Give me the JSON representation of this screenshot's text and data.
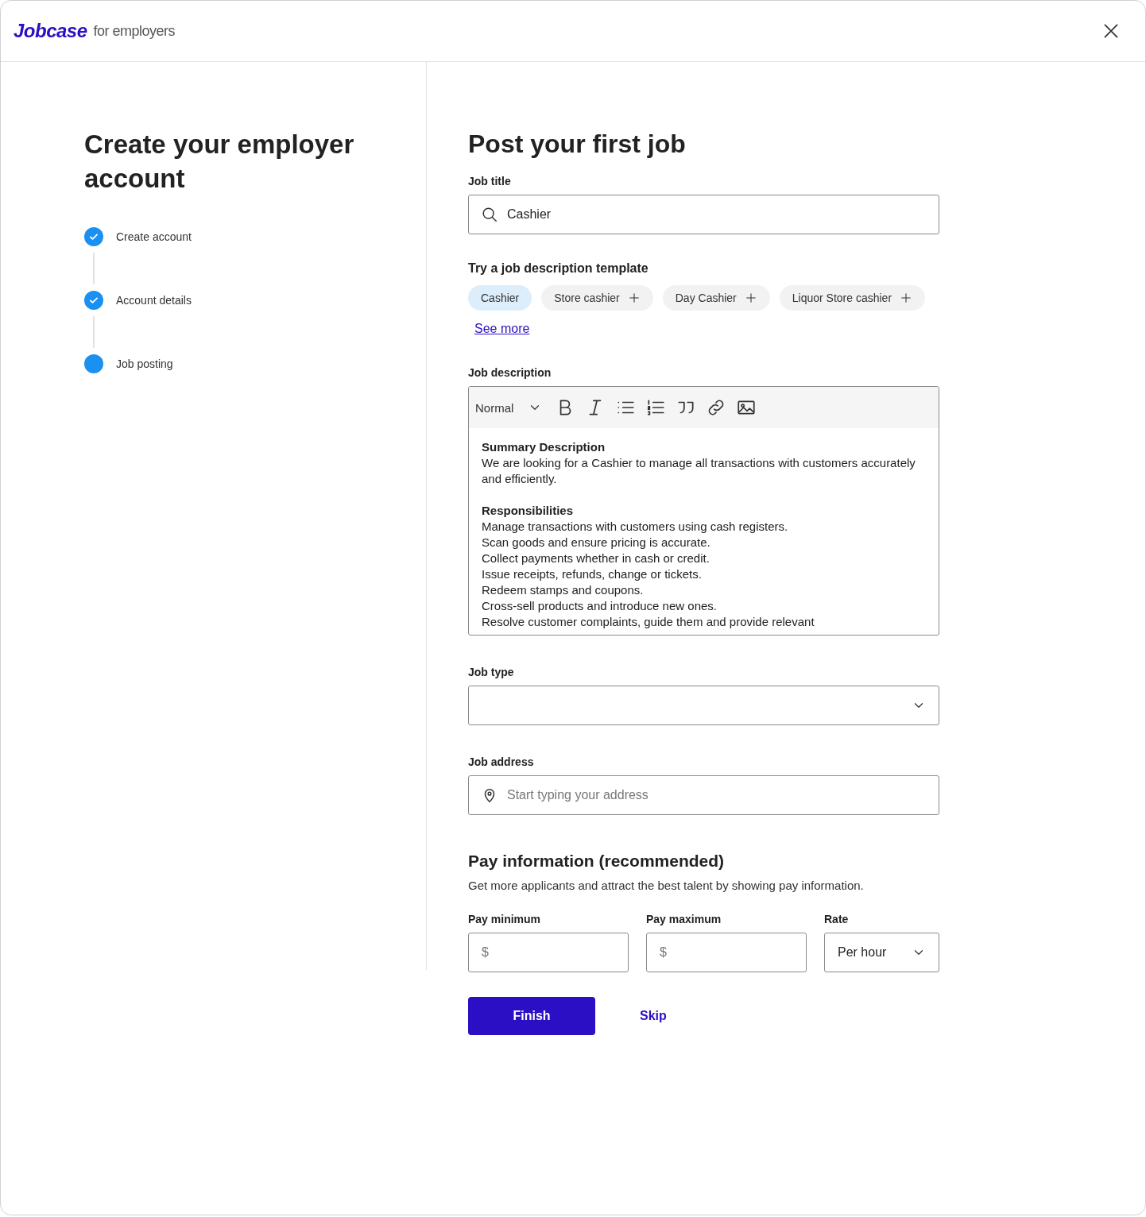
{
  "header": {
    "logo": "Jobcase",
    "tagline": "for employers"
  },
  "sidebar": {
    "title": "Create your employer account",
    "steps": [
      {
        "label": "Create account",
        "done": true
      },
      {
        "label": "Account details",
        "done": true
      },
      {
        "label": "Job posting",
        "done": false
      }
    ]
  },
  "form": {
    "title": "Post your first job",
    "job_title": {
      "label": "Job title",
      "value": "Cashier"
    },
    "templates": {
      "title": "Try a job description template",
      "chips": [
        {
          "label": "Cashier",
          "selected": true
        },
        {
          "label": "Store cashier",
          "selected": false
        },
        {
          "label": "Day Cashier",
          "selected": false
        },
        {
          "label": "Liquor Store cashier",
          "selected": false
        }
      ],
      "see_more": "See more"
    },
    "description": {
      "label": "Job description",
      "format": "Normal",
      "blocks": [
        {
          "heading": "Summary Description",
          "lines": [
            "We are looking for a Cashier to manage all transactions with customers accurately and efficiently."
          ]
        },
        {
          "heading": "Responsibilities",
          "lines": [
            "Manage transactions with customers using cash registers.",
            "Scan goods and ensure pricing is accurate.",
            "Collect payments whether in cash or credit.",
            "Issue receipts, refunds, change or tickets.",
            "Redeem stamps and coupons.",
            "Cross-sell products and introduce new ones.",
            "Resolve customer complaints, guide them and provide relevant"
          ]
        }
      ]
    },
    "job_type": {
      "label": "Job type"
    },
    "job_address": {
      "label": "Job address",
      "placeholder": "Start typing your address"
    },
    "pay": {
      "title": "Pay information (recommended)",
      "subtitle": "Get more applicants and attract the best talent by showing pay information.",
      "minimum": {
        "label": "Pay minimum",
        "placeholder": "$"
      },
      "maximum": {
        "label": "Pay maximum",
        "placeholder": "$"
      },
      "rate": {
        "label": "Rate",
        "value": "Per hour"
      }
    },
    "finish": "Finish",
    "skip": "Skip"
  }
}
